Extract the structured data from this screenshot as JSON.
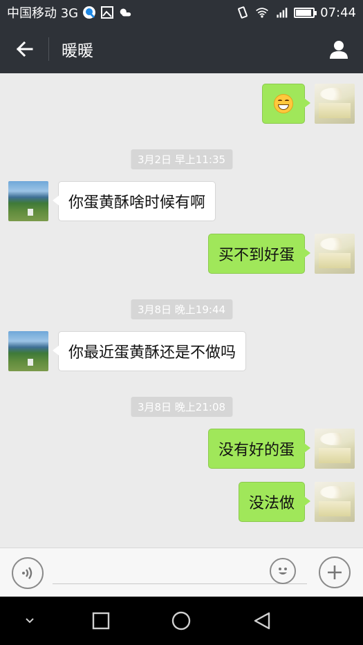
{
  "status_bar": {
    "carrier": "中国移动 3G",
    "time": "07:44",
    "network_label": "3G",
    "icons": [
      "qq-icon",
      "image-icon",
      "weather-icon",
      "vibrate-icon",
      "wifi-icon",
      "signal-icon",
      "battery-icon"
    ]
  },
  "header": {
    "title": "暖暖",
    "back_icon": "arrow-left-icon",
    "profile_icon": "person-icon"
  },
  "messages": [
    {
      "type": "message",
      "side": "right",
      "kind": "emoji",
      "emoji": "grinning-face"
    },
    {
      "type": "timestamp",
      "text": "3月2日 早上11:35"
    },
    {
      "type": "message",
      "side": "left",
      "text": "你蛋黄酥啥时候有啊"
    },
    {
      "type": "message",
      "side": "right",
      "text": "买不到好蛋"
    },
    {
      "type": "timestamp",
      "text": "3月8日 晚上19:44"
    },
    {
      "type": "message",
      "side": "left",
      "text": "你最近蛋黄酥还是不做吗"
    },
    {
      "type": "timestamp",
      "text": "3月8日 晚上21:08"
    },
    {
      "type": "message",
      "side": "right",
      "text": "没有好的蛋"
    },
    {
      "type": "message",
      "side": "right",
      "text": "没法做"
    }
  ],
  "input_bar": {
    "value": "",
    "placeholder": "",
    "voice_icon": "voice-icon",
    "emoji_icon": "smiley-icon",
    "plus_icon": "plus-icon"
  },
  "colors": {
    "header_bg": "#2e3238",
    "chat_bg": "#ebebeb",
    "sent_bubble": "#a0e75a",
    "received_bubble": "#ffffff",
    "timestamp_bg": "#d6d6d6"
  }
}
